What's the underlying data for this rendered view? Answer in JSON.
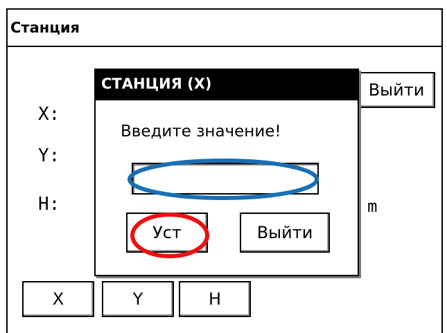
{
  "window": {
    "title": "Станция"
  },
  "labels": {
    "x": "X:",
    "y": "Y:",
    "h": "H:",
    "unit": "m"
  },
  "buttons": {
    "exit_top": "Выйти",
    "x": "X",
    "y": "Y",
    "h": "H"
  },
  "dialog": {
    "title": "СТАНЦИЯ (X)",
    "prompt": "Введите значение!",
    "input_value": "",
    "set_label": "Уст",
    "exit_label": "Выйти"
  },
  "annotations": {
    "input_color": "#1a6fb5",
    "set_color": "#ee1111"
  }
}
